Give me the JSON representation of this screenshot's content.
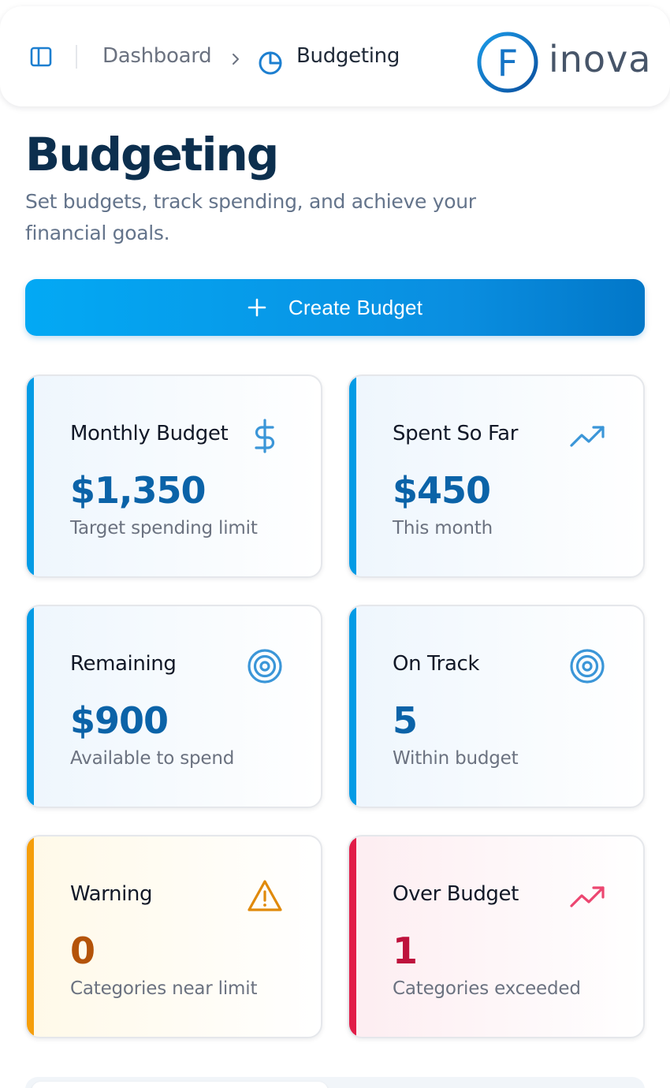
{
  "header": {
    "breadcrumb": {
      "root": "Dashboard",
      "current": "Budgeting"
    },
    "logo": {
      "letter": "F",
      "text": "inova"
    }
  },
  "page": {
    "title": "Budgeting",
    "subtitle": "Set budgets, track spending, and achieve your financial goals."
  },
  "actions": {
    "create_budget_label": "Create Budget"
  },
  "cards": [
    {
      "title": "Monthly Budget",
      "value": "$1,350",
      "caption": "Target spending limit",
      "icon": "dollar-icon",
      "variant": "blue"
    },
    {
      "title": "Spent So Far",
      "value": "$450",
      "caption": "This month",
      "icon": "trending-up-icon",
      "variant": "blue"
    },
    {
      "title": "Remaining",
      "value": "$900",
      "caption": "Available to spend",
      "icon": "target-icon",
      "variant": "blue"
    },
    {
      "title": "On Track",
      "value": "5",
      "caption": "Within budget",
      "icon": "target-icon",
      "variant": "blue"
    },
    {
      "title": "Warning",
      "value": "0",
      "caption": "Categories near limit",
      "icon": "warning-triangle-icon",
      "variant": "amber"
    },
    {
      "title": "Over Budget",
      "value": "1",
      "caption": "Categories exceeded",
      "icon": "trending-up-icon",
      "variant": "red"
    }
  ],
  "colors": {
    "brand_blue": "#039be5",
    "title_navy": "#0c2f4e",
    "value_blue": "#0b63a8",
    "warning_amber": "#f59e0b",
    "danger_red": "#e11d48"
  }
}
